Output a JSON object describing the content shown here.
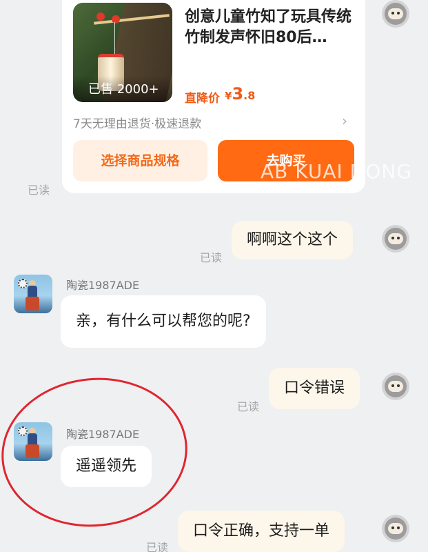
{
  "product": {
    "title": "创意儿童竹知了玩具传统竹制发声怀旧80后…",
    "sold": "已售 2000+",
    "price_label": "直降价",
    "price_symbol": "¥",
    "price_int": "3",
    "price_dec": ".8",
    "returns": "7天无理由退货·极速退款",
    "spec_button": "选择商品规格",
    "buy_button": "去购买"
  },
  "messages": [
    {
      "side": "me",
      "read": "已读",
      "text": "啊啊这个这个"
    },
    {
      "side": "shop",
      "name": "陶瓷1987ADE",
      "text": "亲，有什么可以帮您的呢?"
    },
    {
      "side": "me",
      "read": "已读",
      "text": "口令错误"
    },
    {
      "side": "shop",
      "name": "陶瓷1987ADE",
      "text": "遥遥领先"
    },
    {
      "side": "me",
      "read": "已读",
      "text": "口令正确，支持一单"
    }
  ],
  "card_read": "已读",
  "watermark": "AB KUAI DONG",
  "colors": {
    "accent": "#ff6a13",
    "annotation": "#e0262f"
  }
}
